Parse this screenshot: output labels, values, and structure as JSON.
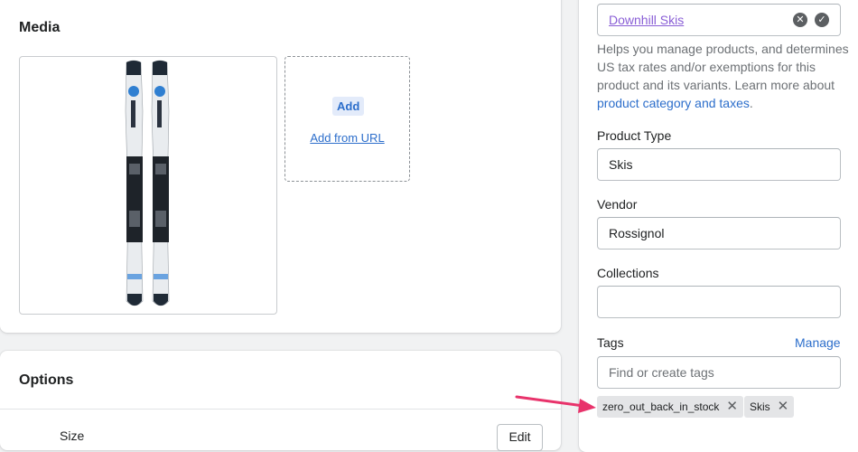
{
  "media": {
    "title": "Media",
    "add_label": "Add",
    "add_url_label": "Add from URL"
  },
  "options": {
    "title": "Options",
    "option_name": "Size",
    "edit_label": "Edit"
  },
  "organization": {
    "category_value": "Downhill Skis",
    "help_text_prefix": "Helps you manage products, and determines US tax rates and/or exemptions for this product and its variants. Learn more about ",
    "help_link": "product category and taxes",
    "help_text_suffix": ".",
    "product_type_label": "Product Type",
    "product_type_value": "Skis",
    "vendor_label": "Vendor",
    "vendor_value": "Rossignol",
    "collections_label": "Collections",
    "collections_value": "",
    "tags_label": "Tags",
    "manage_label": "Manage",
    "tags_placeholder": "Find or create tags",
    "tags": [
      {
        "label": "zero_out_back_in_stock"
      },
      {
        "label": "Skis"
      }
    ]
  },
  "colors": {
    "accent": "#2c6ecb",
    "annotation_arrow": "#e8336b"
  },
  "icons": {
    "clear": "close-circle-icon",
    "confirm": "check-circle-icon",
    "tag_remove": "close-icon"
  }
}
